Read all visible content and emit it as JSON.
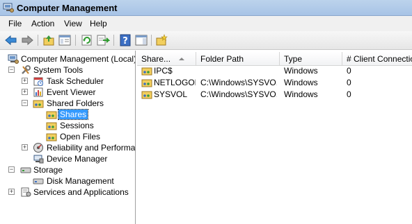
{
  "window": {
    "title": "Computer Management"
  },
  "menu": [
    "File",
    "Action",
    "View",
    "Help"
  ],
  "toolbar": {
    "buttons": [
      "back-arrow-icon",
      "forward-arrow-icon",
      "up-folder-icon",
      "show-hide-tree-icon",
      "refresh-icon",
      "export-list-icon",
      "help-icon",
      "action-pane-icon",
      "new-share-icon"
    ]
  },
  "tree": {
    "root": "Computer Management (Local)",
    "system_tools": "System Tools",
    "task_scheduler": "Task Scheduler",
    "event_viewer": "Event Viewer",
    "shared_folders": "Shared Folders",
    "shares": "Shares",
    "sessions": "Sessions",
    "open_files": "Open Files",
    "reliability": "Reliability and Performance",
    "device_manager": "Device Manager",
    "storage": "Storage",
    "disk_management": "Disk Management",
    "services_apps": "Services and Applications"
  },
  "list": {
    "columns": [
      "Share...",
      "Folder Path",
      "Type",
      "# Client Connections"
    ],
    "rows": [
      {
        "name": "IPC$",
        "path": "",
        "type": "Windows",
        "clients": "0"
      },
      {
        "name": "NETLOGON",
        "path": "C:\\Windows\\SYSVO...",
        "type": "Windows",
        "clients": "0"
      },
      {
        "name": "SYSVOL",
        "path": "C:\\Windows\\SYSVO...",
        "type": "Windows",
        "clients": "0"
      }
    ]
  },
  "colors": {
    "selection": "#3399ff",
    "title_gradient_top": "#bcd3ec"
  }
}
